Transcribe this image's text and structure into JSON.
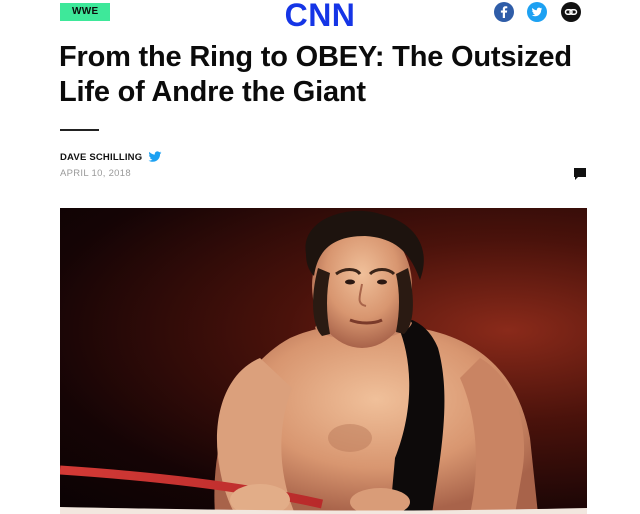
{
  "header": {
    "tag_label": "WWE",
    "logo_text": "CNN",
    "share": [
      {
        "icon": "facebook-icon",
        "color": "#2f5da8"
      },
      {
        "icon": "twitter-icon",
        "color": "#1da1f2"
      },
      {
        "icon": "link-icon",
        "color": "#111111"
      }
    ]
  },
  "article": {
    "headline_line1": "From the Ring to OBEY: The Outsized",
    "headline_line2": "Life of Andre the Giant",
    "author": "DAVE SCHILLING",
    "date": "APRIL 10, 2018",
    "comment_icon": "comment-icon",
    "hero_image": "wrestler-photo"
  },
  "colors": {
    "tag_bg": "#3ee89a",
    "logo": "#1535e6"
  }
}
